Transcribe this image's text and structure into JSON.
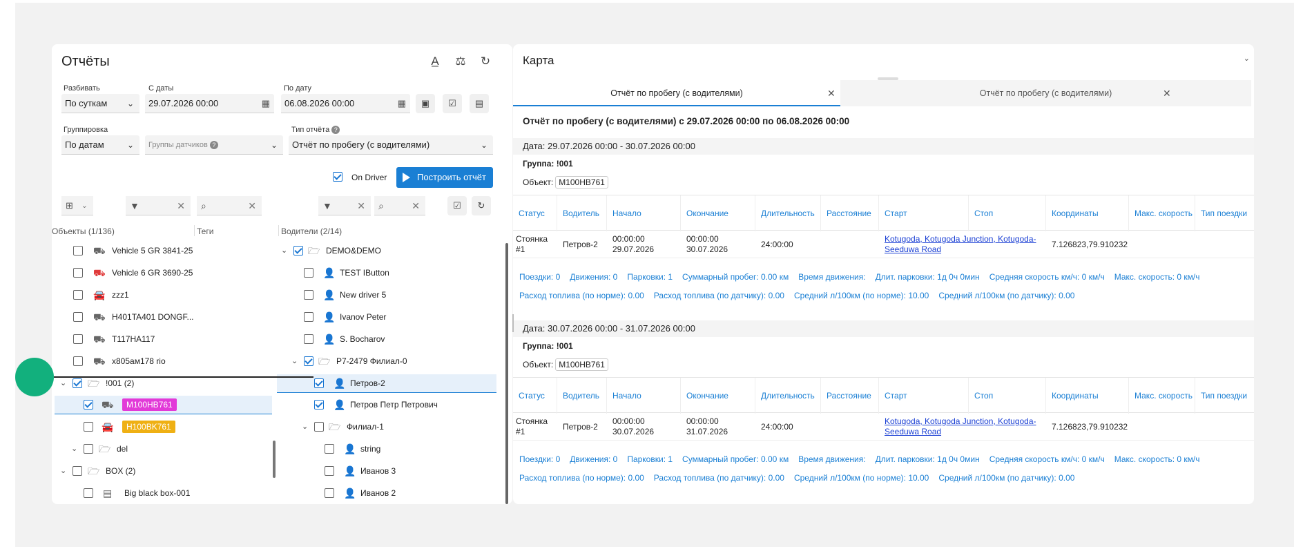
{
  "reports": {
    "title": "Отчёты",
    "split": {
      "label": "Разбивать",
      "value": "По суткам"
    },
    "from": {
      "label": "С даты",
      "value": "29.07.2026 00:00"
    },
    "to": {
      "label": "По дату",
      "value": "06.08.2026 00:00"
    },
    "grouping": {
      "label": "Группировка",
      "value": "По датам"
    },
    "sensor_groups": {
      "placeholder": "Группы датчиков"
    },
    "report_type": {
      "label": "Тип отчёта",
      "value": "Отчёт по пробегу (с водителями)"
    },
    "on_driver": "On Driver",
    "build_button": "Построить отчёт"
  },
  "objects": {
    "header": "Объекты (1/136)",
    "tags_header": "Теги",
    "rows": [
      {
        "label": "Vehicle 5 GR 3841-25"
      },
      {
        "label": "Vehicle 6 GR 3690-25"
      },
      {
        "label": "zzz1"
      },
      {
        "label": "H401TA401 DONGF..."
      },
      {
        "label": "T117HA117"
      },
      {
        "label": "x805ам178 rio"
      },
      {
        "label": "!001 (2)"
      },
      {
        "label": "M100HB761"
      },
      {
        "label": "H100BK761"
      },
      {
        "label": "del"
      },
      {
        "label": "BOX (2)"
      },
      {
        "label": "Big black box-001"
      }
    ]
  },
  "drivers": {
    "header": "Водители (2/14)",
    "rows": [
      {
        "label": "DEMO&DEMO"
      },
      {
        "label": "TEST IButton"
      },
      {
        "label": "New driver 5"
      },
      {
        "label": "Ivanov Peter"
      },
      {
        "label": "S. Bocharov"
      },
      {
        "label": "P7-2479 Филиал-0"
      },
      {
        "label": "Петров-2"
      },
      {
        "label": "Петров Петр Петрович"
      },
      {
        "label": "Филиал-1"
      },
      {
        "label": "string"
      },
      {
        "label": "Иванов 3"
      },
      {
        "label": "Иванов 2"
      }
    ]
  },
  "map": {
    "title": "Карта",
    "tabs": [
      {
        "label": "Отчёт по пробегу (с водителями)"
      },
      {
        "label": "Отчёт по пробегу (с водителями)"
      }
    ]
  },
  "report": {
    "title": "Отчёт по пробегу (с водителями) с 29.07.2026 00:00 по 06.08.2026 00:00",
    "columns": [
      "Статус",
      "Водитель",
      "Начало",
      "Окончание",
      "Длительность",
      "Расстояние",
      "Старт",
      "Стоп",
      "Координаты",
      "Макс. скорость",
      "Тип поездки"
    ],
    "sections": [
      {
        "date": "Дата: 29.07.2026 00:00 - 30.07.2026 00:00",
        "group": "Группа: !001",
        "object_label": "Объект:",
        "object": "M100HB761",
        "row": {
          "status": "Стоянка #1",
          "driver": "Петров-2",
          "start": "00:00:00 29.07.2026",
          "end": "00:00:00 30.07.2026",
          "duration": "24:00:00",
          "distance": "",
          "start_place": "Kotugoda, Kotugoda Junction, Kotugoda-Seeduwa Road",
          "stop_place": "",
          "coords": "7.126823,79.910232",
          "max_speed": "",
          "trip_type": ""
        },
        "summary1": [
          "Поездки: 0",
          "Движения: 0",
          "Парковки: 1",
          "Суммарный пробег: 0.00 км",
          "Время движения:",
          "Длит. парковки: 1д 0ч 0мин",
          "Средняя скорость км/ч: 0 км/ч",
          "Макс. скорость: 0 км/ч"
        ],
        "summary2": [
          "Расход топлива (по норме): 0.00",
          "Расход топлива (по датчику): 0.00",
          "Средний л/100км (по норме): 10.00",
          "Средний л/100км (по датчику): 0.00"
        ]
      },
      {
        "date": "Дата: 30.07.2026 00:00 - 31.07.2026 00:00",
        "group": "Группа: !001",
        "object_label": "Объект:",
        "object": "M100HB761",
        "row": {
          "status": "Стоянка #1",
          "driver": "Петров-2",
          "start": "00:00:00 30.07.2026",
          "end": "00:00:00 31.07.2026",
          "duration": "24:00:00",
          "distance": "",
          "start_place": "Kotugoda, Kotugoda Junction, Kotugoda-Seeduwa Road",
          "stop_place": "",
          "coords": "7.126823,79.910232",
          "max_speed": "",
          "trip_type": ""
        },
        "summary1": [
          "Поездки: 0",
          "Движения: 0",
          "Парковки: 1",
          "Суммарный пробег: 0.00 км",
          "Время движения:",
          "Длит. парковки: 1д 0ч 0мин",
          "Средняя скорость км/ч: 0 км/ч",
          "Макс. скорость: 0 км/ч"
        ],
        "summary2": [
          "Расход топлива (по норме): 0.00",
          "Расход топлива (по датчику): 0.00",
          "Средний л/100км (по норме): 10.00",
          "Средний л/100км (по датчику): 0.00"
        ]
      }
    ]
  },
  "colors": {
    "accent": "#1a7fd4",
    "tag_magenta": "#e23ad8",
    "tag_yellow": "#efb014",
    "drag_dot": "#12b07d"
  }
}
